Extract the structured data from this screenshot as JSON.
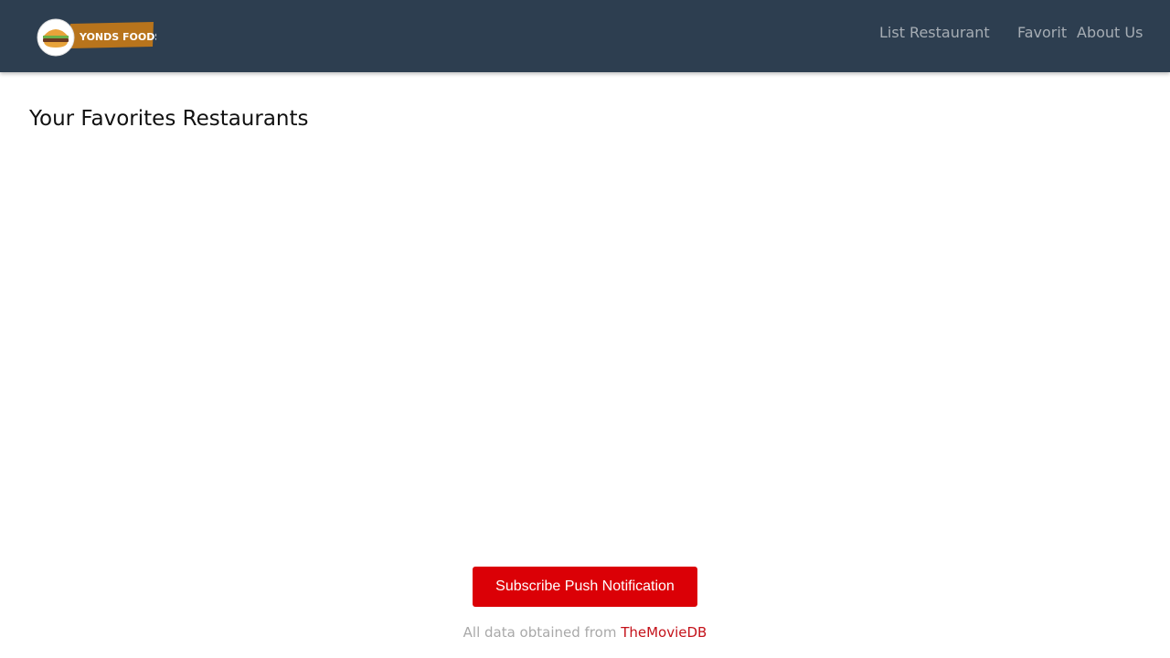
{
  "header": {
    "logo_text": "YONDS FOODS",
    "nav": [
      {
        "label": "List Restaurant"
      },
      {
        "label": "Favorit"
      },
      {
        "label": "About Us"
      }
    ]
  },
  "main": {
    "title": "Your Favorites Restaurants"
  },
  "subscribe": {
    "label": "Subscribe Push Notification"
  },
  "footer": {
    "text": "All data obtained from",
    "link_label": "TheMovieDB"
  },
  "colors": {
    "navbar": "#2d3e50",
    "nav_link": "#a6adb4",
    "button": "#db0006",
    "footer_link": "#c4121a"
  }
}
